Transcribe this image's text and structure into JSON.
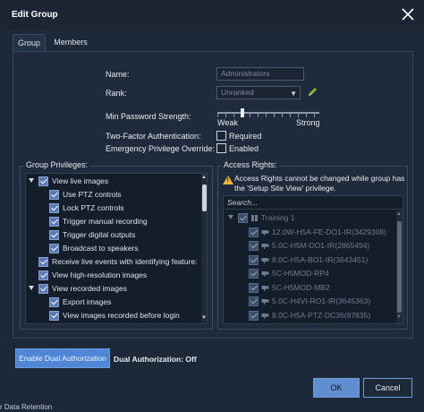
{
  "dialog": {
    "title": "Edit Group"
  },
  "tabs": [
    {
      "label": "Group"
    },
    {
      "label": "Members"
    }
  ],
  "form": {
    "name_label": "Name:",
    "name_value": "Administrators",
    "rank_label": "Rank:",
    "rank_value": "Unranked",
    "min_password_label": "Min Password Strength:",
    "slider_weak": "Weak",
    "slider_strong": "Strong",
    "two_factor_label": "Two-Factor Authentication:",
    "two_factor_option": "Required",
    "emergency_label": "Emergency Privilege Override:",
    "emergency_option": "Enabled"
  },
  "privileges": {
    "legend": "Group Privileges:",
    "items": [
      {
        "label": "View live images",
        "level": 0,
        "expanded": true
      },
      {
        "label": "Use PTZ controls",
        "level": 1
      },
      {
        "label": "Lock PTZ controls",
        "level": 1
      },
      {
        "label": "Trigger manual recording",
        "level": 1
      },
      {
        "label": "Trigger digital outputs",
        "level": 1
      },
      {
        "label": "Broadcast to speakers",
        "level": 1
      },
      {
        "label": "Receive live events with identifying feature:",
        "level": 0
      },
      {
        "label": "View high-resolution images",
        "level": 0
      },
      {
        "label": "View recorded images",
        "level": 0,
        "expanded": true
      },
      {
        "label": "Export images",
        "level": 1
      },
      {
        "label": "View images recorded before login",
        "level": 1
      }
    ]
  },
  "access": {
    "legend": "Access Rights:",
    "warning_line1": "Access Rights cannot be changed while group has",
    "warning_line2": "the 'Setup Site View' privilege.",
    "search_placeholder": "Search...",
    "items": [
      {
        "label": "Training 1",
        "level": 0
      },
      {
        "label": "12.0W-H5A-FE-DO1-IR(3429308)",
        "level": 1
      },
      {
        "label": "5.0C-H5M-DO1-IR(2865494)",
        "level": 1
      },
      {
        "label": "8.0C-H5A-BO1-IR(3643451)",
        "level": 1
      },
      {
        "label": "5C-H5MOD-RP4",
        "level": 1
      },
      {
        "label": "5C-H5MOD-MB2",
        "level": 1
      },
      {
        "label": "5.0C-H4VI-RO1-IR(3645363)",
        "level": 1
      },
      {
        "label": "8.0C-H5A-PTZ-DC36(87835)",
        "level": 1
      }
    ]
  },
  "footer": {
    "dual_button": "Enable Dual Authorization",
    "dual_status": "Dual Authorization: Off",
    "ok": "OK",
    "cancel": "Cancel"
  },
  "background": {
    "bottom_text": "r Data Retention"
  },
  "colors": {
    "accent": "#5f8fd0",
    "warning": "#f2b33d",
    "dialog_bg": "#1d2838"
  }
}
